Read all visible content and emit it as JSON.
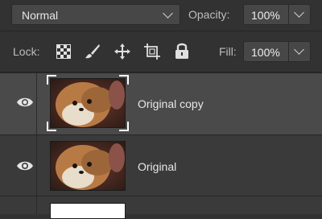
{
  "blend_mode": {
    "value": "Normal"
  },
  "opacity": {
    "label": "Opacity:",
    "value": "100%"
  },
  "lock": {
    "label": "Lock:",
    "icons": [
      "lock-transparent-pixels-icon",
      "lock-image-pixels-icon",
      "lock-position-icon",
      "lock-artboard-icon",
      "lock-all-icon"
    ]
  },
  "fill": {
    "label": "Fill:",
    "value": "100%"
  },
  "layers": [
    {
      "name": "Original copy",
      "visible": true,
      "selected": true
    },
    {
      "name": "Original",
      "visible": true,
      "selected": false
    }
  ],
  "colors": {
    "panel": "#323232",
    "selected_row": "#4a4a4a",
    "row": "#3a3a3a",
    "field": "#474747"
  }
}
